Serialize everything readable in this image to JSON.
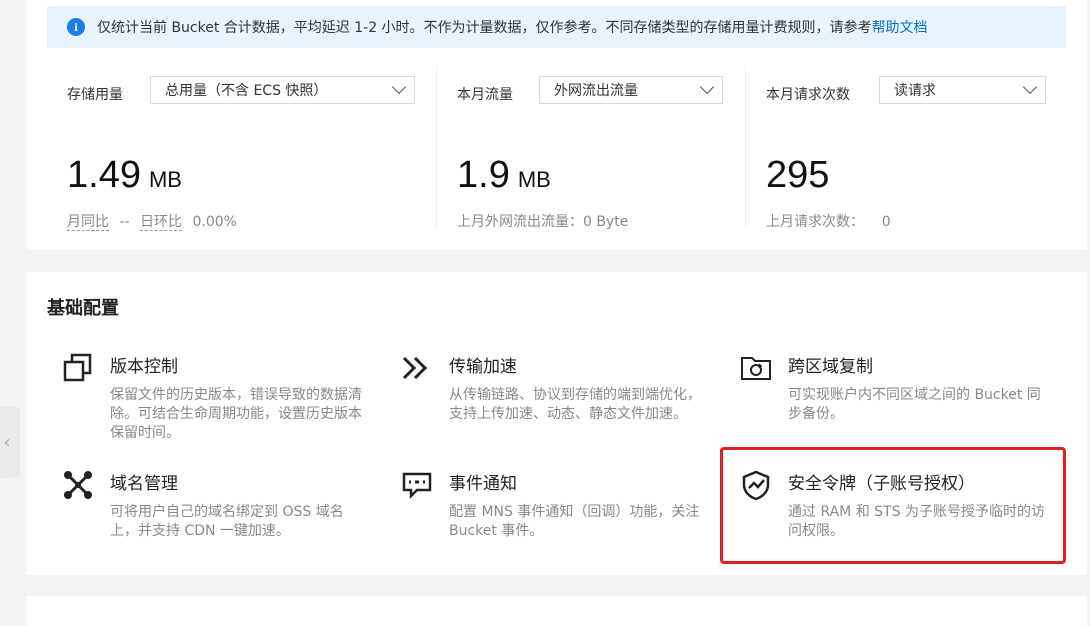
{
  "notice": {
    "text": "仅统计当前 Bucket 合计数据，平均延迟 1-2 小时。不作为计量数据，仅作参考。不同存储类型的存储用量计费规则，请参考",
    "link": "帮助文档"
  },
  "metrics": [
    {
      "label": "存储用量",
      "select": "总用量（不含 ECS 快照）",
      "value": "1.49",
      "unit": "MB",
      "sub1": "月同比",
      "sub_sep": "--",
      "sub2": "日环比",
      "sub3": "0.00%"
    },
    {
      "label": "本月流量",
      "select": "外网流出流量",
      "value": "1.9",
      "unit": "MB",
      "sub": "上月外网流出流量：0 Byte"
    },
    {
      "label": "本月请求次数",
      "select": "读请求",
      "value": "295",
      "unit": "",
      "sub": "上月请求次数：    0"
    }
  ],
  "basic_config": {
    "title": "基础配置",
    "features": [
      {
        "name": "版本控制",
        "desc": "保留文件的历史版本，错误导致的数据清除。可结合生命周期功能，设置历史版本保留时间。",
        "icon": "copy-icon"
      },
      {
        "name": "传输加速",
        "desc": "从传输链路、协议到存储的端到端优化，支持上传加速、动态、静态文件加速。",
        "icon": "double-chevron-icon"
      },
      {
        "name": "跨区域复制",
        "desc": "可实现账户内不同区域之间的 Bucket 同步备份。",
        "icon": "folder-sync-icon"
      },
      {
        "name": "域名管理",
        "desc": "可将用户自己的域名绑定到 OSS 域名上，并支持 CDN 一键加速。",
        "icon": "network-icon"
      },
      {
        "name": "事件通知",
        "desc": "配置 MNS 事件通知（回调）功能，关注 Bucket 事件。",
        "icon": "message-icon"
      },
      {
        "name": "安全令牌（子账号授权）",
        "desc": "通过 RAM 和 STS 为子账号授予临时的访问权限。",
        "icon": "shield-icon"
      }
    ]
  },
  "colors": {
    "highlight": "#e02020",
    "link": "#0070cc",
    "info": "#1e7ee6"
  }
}
